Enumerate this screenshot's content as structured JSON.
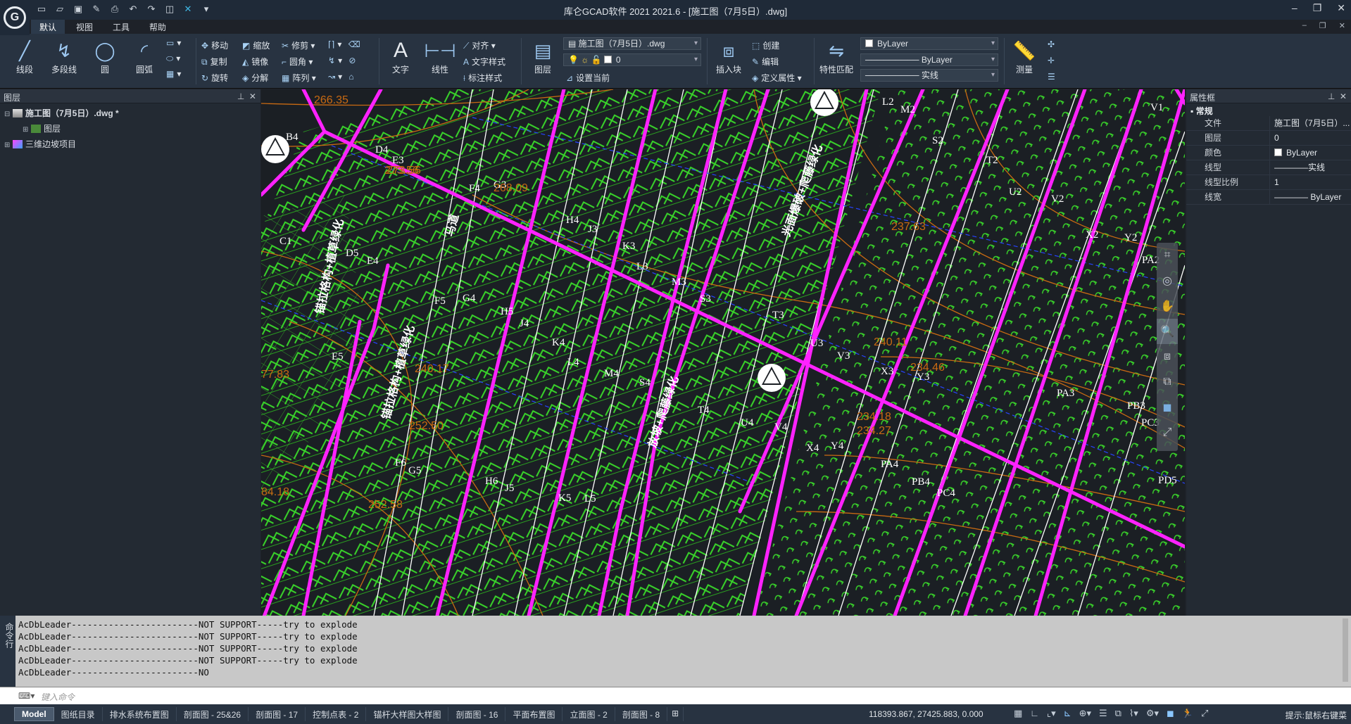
{
  "app": {
    "title": "库仑GCAD软件 2021 2021.6 - [施工图（7月5日）.dwg]",
    "logo_letter": "G"
  },
  "quick_access": [
    "new-icon",
    "open-icon",
    "save-icon",
    "saveas-icon",
    "print-icon",
    "undo-icon",
    "redo-icon",
    "plot-icon",
    "close-file-icon",
    "dropdown-icon"
  ],
  "menu": {
    "tabs": [
      "默认",
      "视图",
      "工具",
      "帮助"
    ]
  },
  "ribbon": {
    "draw": {
      "line": "线段",
      "polyline": "多段线",
      "circle": "圆",
      "arc": "圆弧"
    },
    "modify": {
      "move": "移动",
      "copy": "复制",
      "rotate": "旋转",
      "scale": "缩放",
      "mirror": "镜像",
      "explode": "分解",
      "trim": "修剪",
      "fillet": "圆角",
      "array": "阵列"
    },
    "annotation": {
      "text": "文字",
      "linear": "线性",
      "align": "对齐",
      "text_style": "文字样式",
      "dim_style": "标注样式"
    },
    "layer": {
      "label": "图层",
      "file": "施工图（7月5日）.dwg",
      "current": "0",
      "set_current": "设置当前"
    },
    "block": {
      "insert": "插入块",
      "create": "创建",
      "edit": "编辑",
      "define_attr": "定义属性"
    },
    "properties": {
      "match": "特性匹配",
      "color": "ByLayer",
      "linetype": "ByLayer",
      "lineweight": "实线"
    },
    "measure": "测量"
  },
  "layers_panel": {
    "title": "图层",
    "items": [
      {
        "label": "施工图（7月5日）.dwg *"
      },
      {
        "label": "图层"
      },
      {
        "label": "三维边坡项目"
      }
    ]
  },
  "drawing": {
    "labels": [
      "B4",
      "D4",
      "E3",
      "F4",
      "G3",
      "H4",
      "J3",
      "K3",
      "L3",
      "M3",
      "L2",
      "M2",
      "S2",
      "T2",
      "U2",
      "V2",
      "X2",
      "Y2",
      "V1",
      "C1",
      "D5",
      "E4",
      "F5",
      "G4",
      "H5",
      "J4",
      "K4",
      "L4",
      "M4",
      "S3",
      "T3",
      "U3",
      "V3",
      "X3",
      "Y3",
      "PA2",
      "PA3",
      "PB3",
      "PC3",
      "E5",
      "F6",
      "G5",
      "H6",
      "J5",
      "K5",
      "L5",
      "S4",
      "T4",
      "U4",
      "V4",
      "X4",
      "Y4",
      "PA4",
      "PB4",
      "PC4",
      "PD5"
    ],
    "elevations": [
      "266.35",
      "273.56",
      "268.09",
      "237.63",
      "240.11",
      "234.46",
      "234.18",
      "234.27",
      "252.50",
      "84.18",
      "252.58",
      "77.83",
      "273.56",
      "240.17"
    ],
    "annotations": [
      "马道",
      "放坡+爬藤绿化",
      "光面爆破+爬藤绿化",
      "锚拉格构+植草绿化",
      "锚拉格构+植草绿化"
    ]
  },
  "properties_panel": {
    "title": "属性框",
    "section": "常规",
    "rows": [
      {
        "k": "文件",
        "v": "施工图（7月5日）..."
      },
      {
        "k": "图层",
        "v": "0"
      },
      {
        "k": "颜色",
        "v": "ByLayer"
      },
      {
        "k": "线型",
        "v": "————实线"
      },
      {
        "k": "线型比例",
        "v": "1"
      },
      {
        "k": "线宽",
        "v": "———— ByLayer"
      }
    ]
  },
  "command": {
    "side_label": "命令行",
    "lines": [
      "AcDbLeader------------------------NOT SUPPORT-----try to explode",
      "AcDbLeader------------------------NOT SUPPORT-----try to explode",
      "AcDbLeader------------------------NOT SUPPORT-----try to explode",
      "AcDbLeader------------------------NOT SUPPORT-----try to explode",
      "AcDbLeader------------------------NO"
    ],
    "placeholder": "键入命令"
  },
  "status": {
    "tabs": [
      "Model",
      "图纸目录",
      "排水系统布置图",
      "剖面图 - 25&26",
      "剖面图 - 17",
      "控制点表 - 2",
      "锚杆大样图大样图",
      "剖面图 - 16",
      "平面布置图",
      "立面图 - 2",
      "剖面图 - 8"
    ],
    "coords": "118393.867, 27425.883, 0.000",
    "hint": "提示:鼠标右键菜"
  },
  "colors": {
    "magenta": "#ff22ff",
    "green": "#39d42a",
    "orange": "#c96a12",
    "white": "#ffffff",
    "blue": "#2744ff",
    "background": "#1b1f24"
  }
}
